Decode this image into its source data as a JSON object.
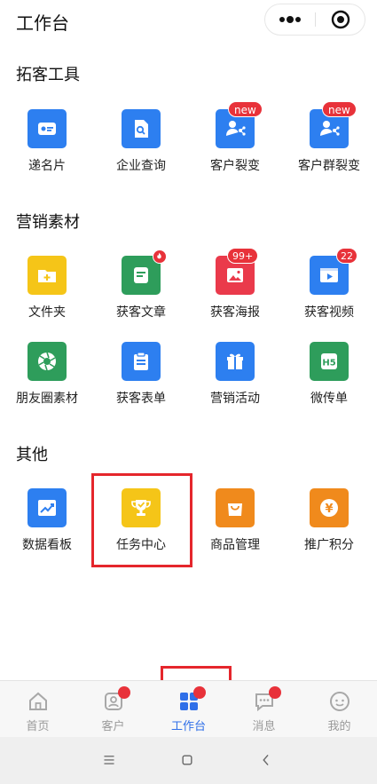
{
  "header": {
    "title": "工作台",
    "more_icon": "more-dots-icon",
    "close_icon": "target-circle-icon"
  },
  "sections": [
    {
      "title": "拓客工具"
    },
    {
      "title": "营销素材"
    },
    {
      "title": "其他"
    }
  ],
  "tools": [
    {
      "label": "递名片",
      "icon": "business-card-icon",
      "color": "#2d7ff0"
    },
    {
      "label": "企业查询",
      "icon": "document-search-icon",
      "color": "#2d7ff0"
    },
    {
      "label": "客户裂变",
      "icon": "user-share-icon",
      "color": "#2d7ff0",
      "badge": "new"
    },
    {
      "label": "客户群裂变",
      "icon": "group-share-icon",
      "color": "#2d7ff0",
      "badge": "new"
    }
  ],
  "materials": [
    {
      "label": "文件夹",
      "icon": "folder-plus-icon",
      "color": "#f5c518"
    },
    {
      "label": "获客文章",
      "icon": "article-icon",
      "color": "#2e9d5b",
      "badge": "fire"
    },
    {
      "label": "获客海报",
      "icon": "poster-image-icon",
      "color": "#ea3a4b",
      "badge": "99+"
    },
    {
      "label": "获客视频",
      "icon": "video-play-icon",
      "color": "#2d7ff0",
      "badge": "22"
    },
    {
      "label": "朋友圈素材",
      "icon": "camera-shutter-icon",
      "color": "#2e9d5b"
    },
    {
      "label": "获客表单",
      "icon": "clipboard-form-icon",
      "color": "#2d7ff0"
    },
    {
      "label": "营销活动",
      "icon": "gift-box-icon",
      "color": "#2d7ff0"
    },
    {
      "label": "微传单",
      "icon": "h5-page-icon",
      "color": "#2e9d5b",
      "icon_text": "H5"
    }
  ],
  "others": [
    {
      "label": "数据看板",
      "icon": "trend-chart-icon",
      "color": "#2d7ff0"
    },
    {
      "label": "任务中心",
      "icon": "trophy-icon",
      "color": "#f5c518"
    },
    {
      "label": "商品管理",
      "icon": "shopping-bag-icon",
      "color": "#f08a1c"
    },
    {
      "label": "推广积分",
      "icon": "yen-coin-icon",
      "color": "#f08a1c",
      "icon_text": "¥"
    }
  ],
  "tabbar": [
    {
      "label": "首页",
      "icon": "home-icon",
      "active": false,
      "dot": false
    },
    {
      "label": "客户",
      "icon": "customer-card-icon",
      "active": false,
      "dot": true
    },
    {
      "label": "工作台",
      "icon": "grid-apps-icon",
      "active": true,
      "dot": true
    },
    {
      "label": "消息",
      "icon": "chat-bubble-icon",
      "active": false,
      "dot": true
    },
    {
      "label": "我的",
      "icon": "smiley-face-icon",
      "active": false,
      "dot": false
    }
  ],
  "system_nav": {
    "menu_icon": "menu-icon",
    "home_icon": "square-home-icon",
    "back_icon": "back-chevron-icon"
  },
  "colors": {
    "accent": "#2f6fe8",
    "badge": "#e8323a",
    "highlight": "#e5262c"
  }
}
